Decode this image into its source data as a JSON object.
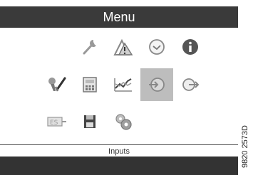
{
  "header": {
    "title": "Menu"
  },
  "menu": {
    "items": [
      {
        "icon": "wrench-icon",
        "selected": false
      },
      {
        "icon": "warning-signal-icon",
        "selected": false
      },
      {
        "icon": "clock-icon",
        "selected": false
      },
      {
        "icon": "info-icon",
        "selected": false
      },
      {
        "icon": "service-check-icon",
        "selected": false
      },
      {
        "icon": "calculator-icon",
        "selected": false
      },
      {
        "icon": "trend-graph-icon",
        "selected": false
      },
      {
        "icon": "inputs-icon",
        "selected": true
      },
      {
        "icon": "outputs-icon",
        "selected": false
      },
      {
        "icon": "es-network-icon",
        "selected": false
      },
      {
        "icon": "save-disk-icon",
        "selected": false
      },
      {
        "icon": "settings-gears-icon",
        "selected": false
      }
    ]
  },
  "status": {
    "label": "Inputs"
  },
  "figure": {
    "code": "9820 2573D"
  }
}
